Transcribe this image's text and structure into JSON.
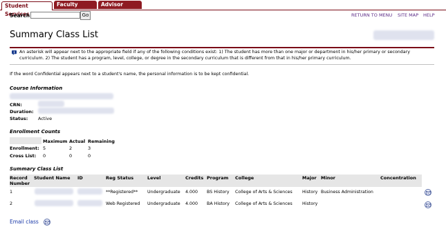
{
  "tabs": [
    {
      "label": "Student Services",
      "active": true
    },
    {
      "label": "Faculty Services",
      "active": false
    },
    {
      "label": "Advisor Services",
      "active": false
    }
  ],
  "search": {
    "label": "Search",
    "value": "",
    "button": "Go"
  },
  "toplinks": {
    "return": "RETURN TO MENU",
    "sitemap": "SITE MAP",
    "help": "HELP"
  },
  "page_title": "Summary Class List",
  "note": "An asterisk will appear next to the appropriate field if any of the following conditions exist: 1) The student has more than one major or department in his/her primary or secondary curriculum. 2) The student has a program, level, college, or degree in the secondary curriculum that is different from that in his/her primary curriculum.",
  "confidential": "If the word Confidential appears next to a student's name, the personal information is to be kept confidential.",
  "course_info": {
    "heading": "Course Information",
    "crn_label": "CRN:",
    "duration_label": "Duration:",
    "status_label": "Status:",
    "status_value": "Active"
  },
  "enrollment": {
    "heading": "Enrollment Counts",
    "columns": [
      "Maximum",
      "Actual",
      "Remaining"
    ],
    "rows": [
      {
        "label": "Enrollment:",
        "values": [
          "5",
          "2",
          "3"
        ]
      },
      {
        "label": "Cross List:",
        "values": [
          "0",
          "0",
          "0"
        ]
      }
    ]
  },
  "class_list": {
    "heading": "Summary Class List",
    "columns": [
      "Record Number",
      "Student Name",
      "ID",
      "Reg Status",
      "Level",
      "Credits",
      "Program",
      "College",
      "Major",
      "Minor",
      "Concentration"
    ],
    "rows": [
      {
        "record": "1",
        "reg_status": "**Registered**",
        "level": "Undergraduate",
        "credits": "4.000",
        "program": "BS History",
        "college": "College of Arts & Sciences",
        "major": "History",
        "minor": "Business Administration",
        "concentration": ""
      },
      {
        "record": "2",
        "reg_status": "Web Registered",
        "level": "Undergraduate",
        "credits": "4.000",
        "program": "BA History",
        "college": "College of Arts & Sciences",
        "major": "History",
        "minor": "",
        "concentration": ""
      }
    ]
  },
  "email_class": "Email class",
  "colors": {
    "brand": "#7a0b16",
    "tab_inactive": "#8e1b22",
    "link": "#5b2a86",
    "email": "#1a39a8"
  },
  "icons": {
    "info": "info-icon",
    "email": "envelope-icon"
  }
}
